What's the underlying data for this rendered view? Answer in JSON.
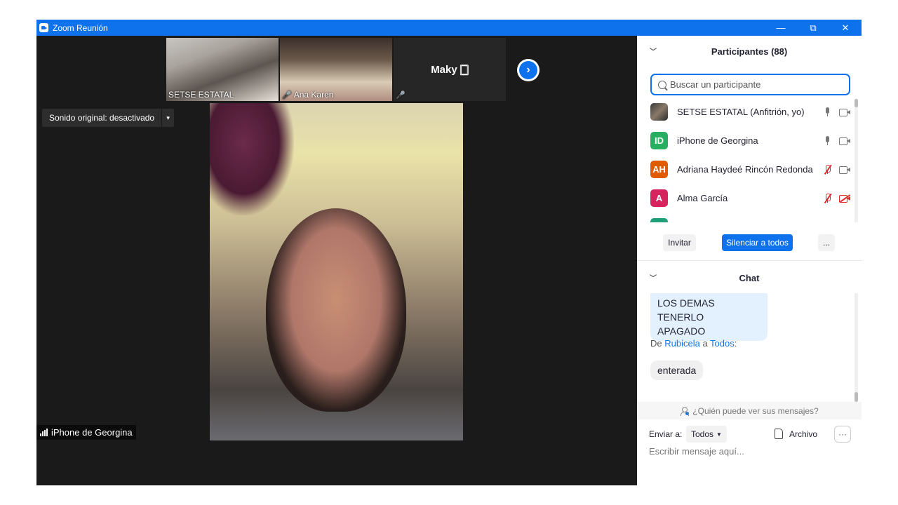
{
  "window": {
    "title": "Zoom Reunión",
    "controls": [
      "—",
      "⧉",
      "✕"
    ]
  },
  "thumbnails": [
    {
      "label": "SETSE ESTATAL",
      "muted": false
    },
    {
      "label": "Ana Karen",
      "muted": true
    },
    {
      "label": "Maky 🀆",
      "muted": true
    }
  ],
  "sound_button": {
    "label": "Sonido original: desactivado",
    "arrow": "▾"
  },
  "main_video": {
    "name": "iPhone de Georgina"
  },
  "next_arrow": "›",
  "participants": {
    "title": "Participantes (88)",
    "collapse_icon": "chevron-down-icon",
    "search_placeholder": "Buscar un participante",
    "list": [
      {
        "initials": "",
        "name": "SETSE ESTATAL (Anfitrión, yo)",
        "color": "#6b5a4a",
        "mic_off": false,
        "cam_off": false
      },
      {
        "initials": "ID",
        "name": "iPhone de Georgina",
        "color": "#27ae60",
        "mic_off": false,
        "cam_off": false
      },
      {
        "initials": "AH",
        "name": "Adriana Haydeé Rincón Redonda",
        "color": "#e05a00",
        "mic_off": true,
        "cam_off": false
      },
      {
        "initials": "A",
        "name": "Alma García",
        "color": "#d6245f",
        "mic_off": true,
        "cam_off": true
      },
      {
        "initials": "",
        "name": "",
        "color": "#1f9e7a",
        "mic_off": true,
        "cam_off": false
      }
    ],
    "buttons": {
      "invite": "Invitar",
      "mute_all": "Silenciar a todos",
      "more": "..."
    }
  },
  "chat": {
    "title": "Chat",
    "messages": [
      {
        "text_line1": "LOS DEMAS TENERLO",
        "text_line2": "APAGADO"
      }
    ],
    "from_prefix": "De ",
    "from_name": "Rubicela",
    "from_mid": " a ",
    "from_to": "Todos",
    "from_suffix": ":",
    "last_message": "enterada",
    "who_can_see": "¿Quién puede ver sus mensajes?",
    "send_to_label": "Enviar a:",
    "send_to_value": "Todos",
    "file_label": "Archivo",
    "more": "···",
    "input_placeholder": "Escribir mensaje aquí..."
  }
}
